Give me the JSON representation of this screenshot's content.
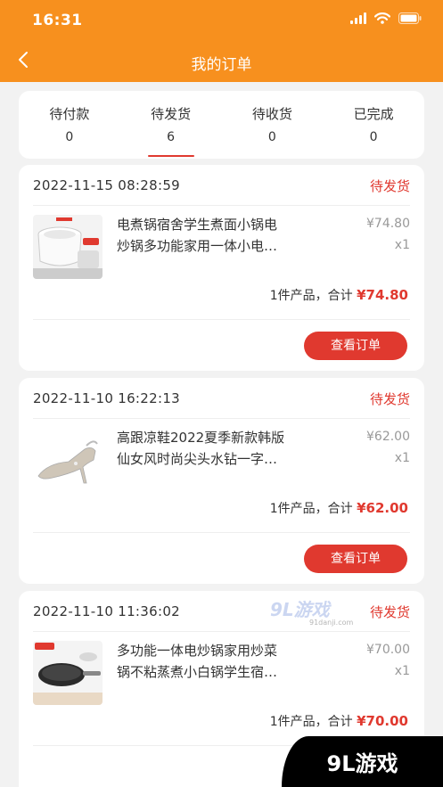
{
  "status_bar": {
    "time": "16:31"
  },
  "header": {
    "title": "我的订单"
  },
  "tabs": [
    {
      "label": "待付款",
      "count": "0"
    },
    {
      "label": "待发货",
      "count": "6"
    },
    {
      "label": "待收货",
      "count": "0"
    },
    {
      "label": "已完成",
      "count": "0"
    }
  ],
  "orders": [
    {
      "date": "2022-11-15 08:28:59",
      "status": "待发货",
      "title_line1": "电煮锅宿舍学生煮面小锅电",
      "title_line2": "炒锅多功能家用一体小电…",
      "price": "¥74.80",
      "qty": "x1",
      "summary_prefix": "1件产品，合计",
      "total": "¥74.80",
      "button": "查看订单"
    },
    {
      "date": "2022-11-10 16:22:13",
      "status": "待发货",
      "title_line1": "高跟凉鞋2022夏季新款韩版",
      "title_line2": "仙女风时尚尖头水钻一字…",
      "price": "¥62.00",
      "qty": "x1",
      "summary_prefix": "1件产品，合计",
      "total": "¥62.00",
      "button": "查看订单"
    },
    {
      "date": "2022-11-10 11:36:02",
      "status": "待发货",
      "title_line1": "多功能一体电炒锅家用炒菜",
      "title_line2": "锅不粘蒸煮小白锅学生宿…",
      "price": "¥70.00",
      "qty": "x1",
      "summary_prefix": "1件产品，合计",
      "total": "¥70.00"
    }
  ],
  "watermark": {
    "center_text": "9L游戏",
    "center_url": "91danji.com",
    "corner_text": "9L游戏"
  }
}
